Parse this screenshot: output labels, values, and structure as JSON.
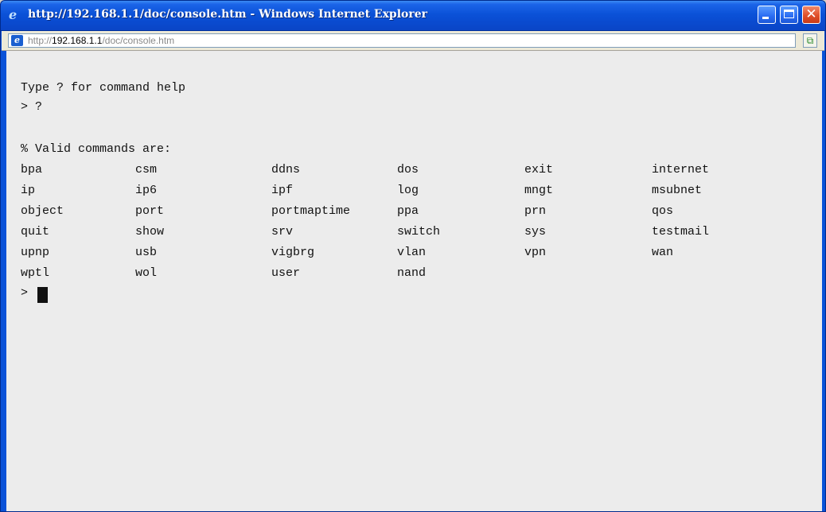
{
  "window": {
    "title": "http://192.168.1.1/doc/console.htm - Windows Internet Explorer"
  },
  "address_bar": {
    "url_prefix": "http://",
    "url_host": "192.168.1.1",
    "url_path": "/doc/console.htm"
  },
  "console": {
    "help_line": "Type ? for command help",
    "prompt_query": "> ?",
    "valid_header": "% Valid commands are:",
    "commands": [
      [
        "bpa",
        "csm",
        "ddns",
        "dos",
        "exit",
        "internet"
      ],
      [
        "ip",
        "ip6",
        "ipf",
        "log",
        "mngt",
        "msubnet"
      ],
      [
        "object",
        "port",
        "portmaptime",
        "ppa",
        "prn",
        "qos"
      ],
      [
        "quit",
        "show",
        "srv",
        "switch",
        "sys",
        "testmail"
      ],
      [
        "upnp",
        "usb",
        "vigbrg",
        "vlan",
        "vpn",
        "wan"
      ],
      [
        "wptl",
        "wol",
        "user",
        "nand"
      ]
    ],
    "prompt": ">"
  }
}
